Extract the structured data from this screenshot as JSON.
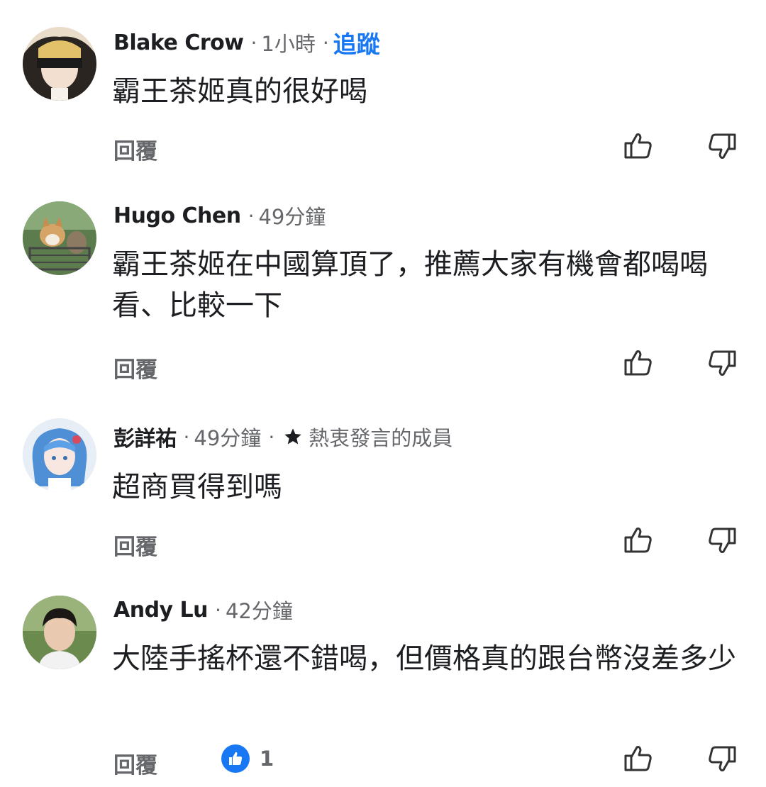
{
  "comments": [
    {
      "name": "Blake Crow",
      "time": "1小時",
      "follow_label": "追蹤",
      "text": "霸王茶姬真的很好喝",
      "reply_label": "回覆",
      "avatar": "anime-girl-blindfold-avatar"
    },
    {
      "name": "Hugo Chen",
      "time": "49分鐘",
      "text": "霸王茶姬在中國算頂了，推薦大家有機會都喝喝看、比較一下",
      "reply_label": "回覆",
      "avatar": "shiba-dog-and-cat-avatar"
    },
    {
      "name": "彭詳祐",
      "time": "49分鐘",
      "badge": "熱衷發言的成員",
      "text": "超商買得到嗎",
      "reply_label": "回覆",
      "avatar": "anime-blue-hair-girl-avatar"
    },
    {
      "name": "Andy Lu",
      "time": "42分鐘",
      "text": "大陸手搖杯還不錯喝，但價格真的跟台幣沒差多少",
      "reply_label": "回覆",
      "reaction_count": "1",
      "avatar": "young-man-portrait-avatar"
    }
  ],
  "icons": {
    "like": "thumbs-up-icon",
    "dislike": "thumbs-down-icon",
    "star": "star-icon"
  },
  "colors": {
    "accent": "#1877f2",
    "meta": "#65676b",
    "text": "#1c1e21"
  }
}
